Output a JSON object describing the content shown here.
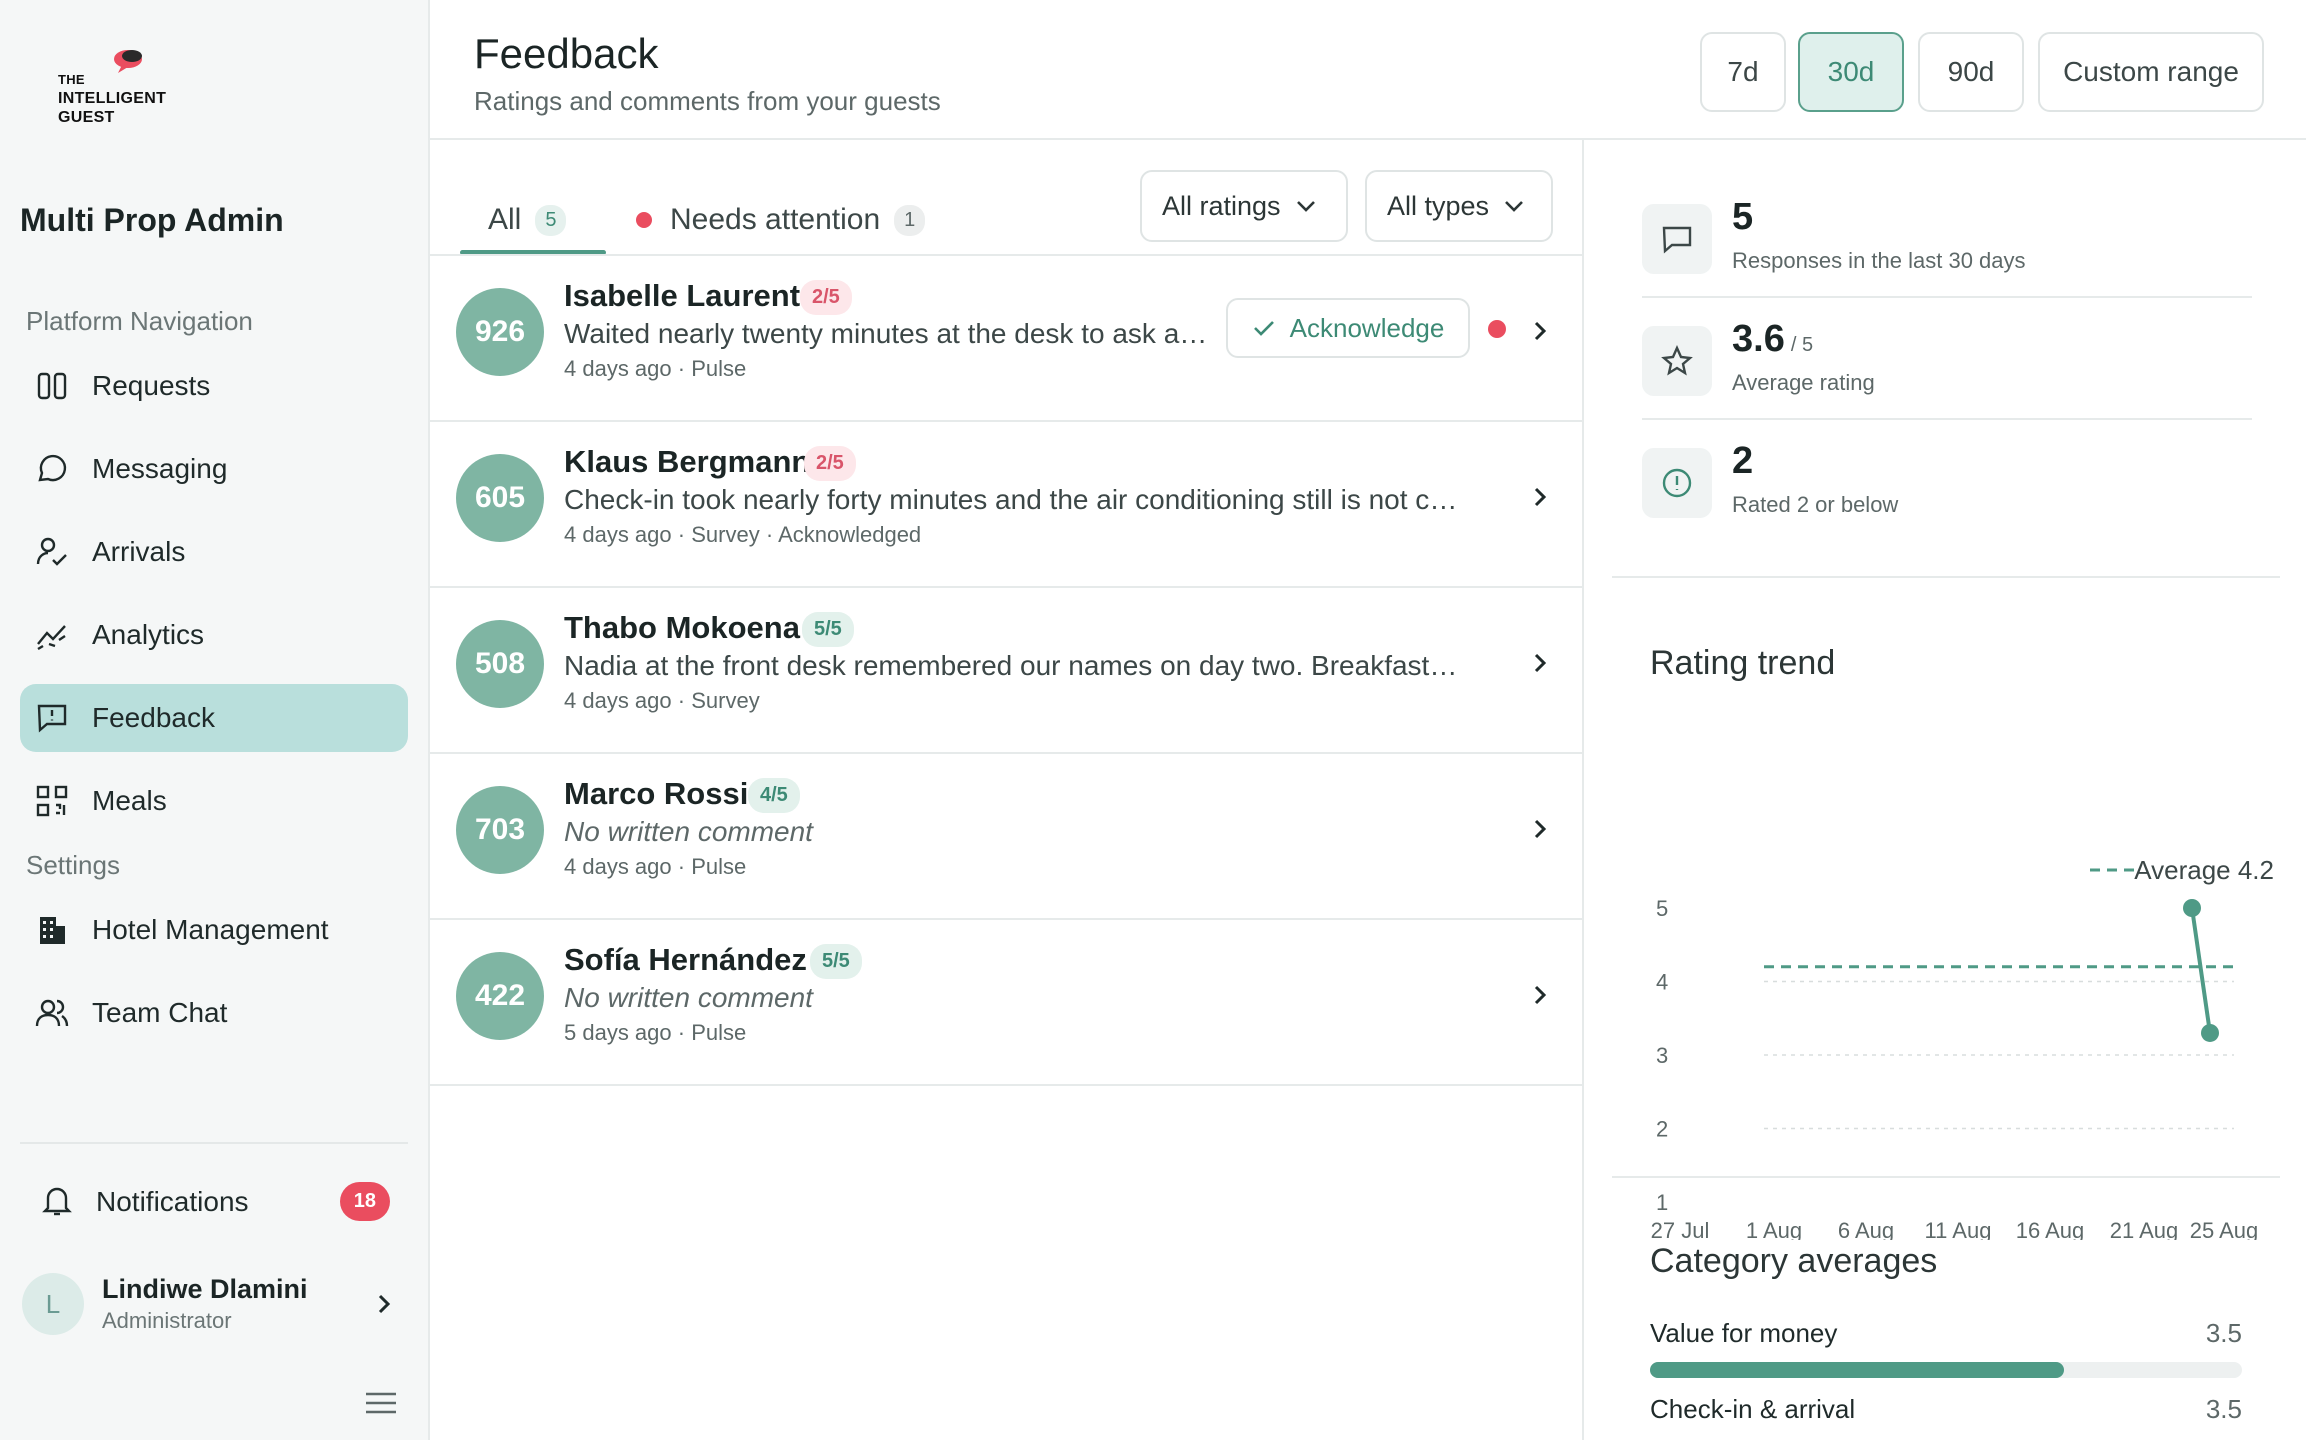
{
  "brand": {
    "logo_line1": "THE",
    "logo_line2": "INTELLIGENT",
    "logo_line3": "GUEST"
  },
  "sidebar": {
    "org_name": "Multi Prop Admin",
    "section_nav": "Platform Navigation",
    "section_settings": "Settings",
    "items": [
      {
        "label": "Requests",
        "icon": "columns-icon"
      },
      {
        "label": "Messaging",
        "icon": "chat-bubble-icon"
      },
      {
        "label": "Arrivals",
        "icon": "person-check-icon"
      },
      {
        "label": "Analytics",
        "icon": "trend-icon"
      },
      {
        "label": "Feedback",
        "icon": "feedback-icon",
        "active": true
      },
      {
        "label": "Meals",
        "icon": "qr-icon"
      }
    ],
    "settings_items": [
      {
        "label": "Hotel Management",
        "icon": "building-icon"
      },
      {
        "label": "Team Chat",
        "icon": "users-icon"
      }
    ],
    "notifications": {
      "label": "Notifications",
      "count": "18"
    },
    "user": {
      "initial": "L",
      "name": "Lindiwe Dlamini",
      "role": "Administrator"
    }
  },
  "header": {
    "title": "Feedback",
    "subtitle": "Ratings and comments from your guests",
    "ranges": [
      "7d",
      "30d",
      "90d",
      "Custom range"
    ],
    "active_range": "30d"
  },
  "tabs": {
    "all_label": "All",
    "all_count": "5",
    "attention_label": "Needs attention",
    "attention_count": "1"
  },
  "filters": {
    "ratings": "All ratings",
    "types": "All types"
  },
  "feedback": [
    {
      "room": "926",
      "guest": "Isabelle Laurent",
      "rating": "2/5",
      "comment": "Waited nearly twenty minutes at the desk to ask abo…",
      "time": "4 days ago",
      "source": "Pulse",
      "status": "",
      "ack_label": "Acknowledge",
      "empty": false
    },
    {
      "room": "605",
      "guest": "Klaus Bergmann",
      "rating": "2/5",
      "comment": "Check-in took nearly forty minutes and the air conditioning still is not cooling.",
      "time": "4 days ago",
      "source": "Survey",
      "status": "Acknowledged",
      "empty": false
    },
    {
      "room": "508",
      "guest": "Thabo Mokoena",
      "rating": "5/5",
      "comment": "Nadia at the front desk remembered our names on day two. Breakfast at Pal…",
      "time": "4 days ago",
      "source": "Survey",
      "status": "",
      "empty": false
    },
    {
      "room": "703",
      "guest": "Marco Rossi",
      "rating": "4/5",
      "comment": "No written comment",
      "time": "4 days ago",
      "source": "Pulse",
      "status": "",
      "empty": true
    },
    {
      "room": "422",
      "guest": "Sofía Hernández",
      "rating": "5/5",
      "comment": "No written comment",
      "time": "5 days ago",
      "source": "Pulse",
      "status": "",
      "empty": true
    }
  ],
  "separator": "·",
  "stats": [
    {
      "value": "5",
      "suffix": "",
      "label": "Responses in the last 30 days",
      "icon": "message-square-icon"
    },
    {
      "value": "3.6",
      "suffix": "/ 5",
      "label": "Average rating",
      "icon": "star-icon"
    },
    {
      "value": "2",
      "suffix": "",
      "label": "Rated 2 or below",
      "icon": "alert-circle-icon"
    }
  ],
  "rating_trend": {
    "title": "Rating trend",
    "legend": "Average 4.2"
  },
  "chart_data": {
    "type": "line",
    "title": "Rating trend",
    "x": [
      "27 Jul",
      "1 Aug",
      "6 Aug",
      "11 Aug",
      "16 Aug",
      "21 Aug",
      "25 Aug"
    ],
    "ylim": [
      1,
      5
    ],
    "yticks": [
      "5",
      "4",
      "3",
      "2",
      "1"
    ],
    "series": [
      {
        "points": [
          {
            "x": "21 Aug",
            "y": 5
          },
          {
            "x": "22 Aug",
            "y": 3.3
          }
        ]
      }
    ],
    "average_line": {
      "label": "Average 4.2",
      "y": 4.2
    },
    "grid": true,
    "legend_position": "top-right"
  },
  "category_averages": {
    "title": "Category averages",
    "items": [
      {
        "label": "Value for money",
        "value": "3.5",
        "fraction": 0.7
      },
      {
        "label": "Check-in & arrival",
        "value": "3.5",
        "fraction": 0.7
      }
    ]
  },
  "colors": {
    "accent": "#4f9a86",
    "danger": "#ea4d5f",
    "active_nav": "#b9dfdc"
  }
}
